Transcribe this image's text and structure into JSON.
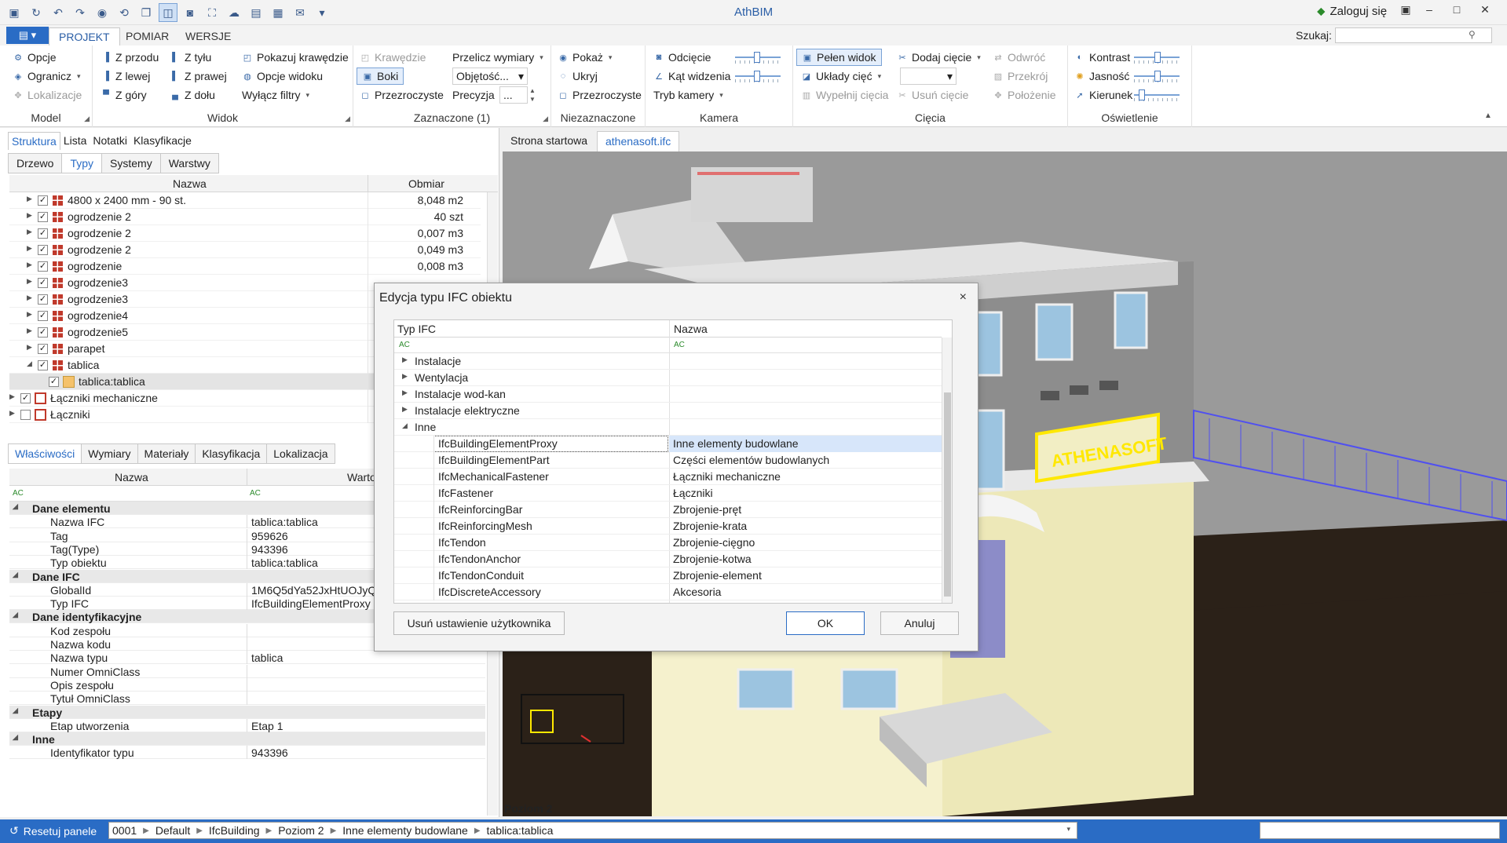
{
  "app": {
    "title": "AthBIM",
    "login": "Zaloguj się",
    "menu_tabs": [
      "PROJEKT",
      "POMIAR",
      "WERSJE"
    ],
    "search_label": "Szukaj:",
    "search_value": ""
  },
  "ribbon": {
    "model": {
      "label": "Model",
      "items": [
        "Opcje",
        "Ogranicz",
        "Lokalizacje"
      ]
    },
    "widok": {
      "label": "Widok",
      "items": [
        "Z przodu",
        "Z tyłu",
        "Z lewej",
        "Z prawej",
        "Z góry",
        "Z dołu",
        "Pokazuj krawędzie",
        "Opcje widoku",
        "Wyłącz filtry"
      ]
    },
    "zaznaczone": {
      "label": "Zaznaczone (1)",
      "items": [
        "Krawędzie",
        "Boki",
        "Przezroczyste",
        "Przelicz wymiary",
        "Objętość...",
        "Precyzja",
        "..."
      ]
    },
    "niezaznaczone": {
      "label": "Niezaznaczone",
      "items": [
        "Pokaż",
        "Ukryj",
        "Przezroczyste"
      ]
    },
    "kamera": {
      "label": "Kamera",
      "items": [
        "Odcięcie",
        "Kąt widzenia",
        "Tryb kamery"
      ]
    },
    "ciecia": {
      "label": "Cięcia",
      "items": [
        "Pełen widok",
        "Układy cięć",
        "Wypełnij cięcia",
        "Dodaj cięcie",
        "Usuń cięcie",
        "Odwróć",
        "Przekrój",
        "Położenie"
      ]
    },
    "oswietlenie": {
      "label": "Oświetlenie",
      "items": [
        "Kontrast",
        "Jasność",
        "Kierunek"
      ]
    }
  },
  "left_panel": {
    "tabs": [
      "Struktura",
      "Lista",
      "Notatki",
      "Klasyfikacje"
    ],
    "subtabs": [
      "Drzewo",
      "Typy",
      "Systemy",
      "Warstwy"
    ],
    "tree_headers": [
      "Nazwa",
      "Obmiar"
    ],
    "tree_rows": [
      {
        "name": "4800 x 2400 mm - 90 st.",
        "value": "8,048 m2"
      },
      {
        "name": "ogrodzenie 2",
        "value": "40 szt"
      },
      {
        "name": "ogrodzenie 2",
        "value": "0,007 m3"
      },
      {
        "name": "ogrodzenie 2",
        "value": "0,049 m3"
      },
      {
        "name": "ogrodzenie",
        "value": "0,008 m3"
      },
      {
        "name": "ogrodzenie3",
        "value": ""
      },
      {
        "name": "ogrodzenie3",
        "value": ""
      },
      {
        "name": "ogrodzenie4",
        "value": ""
      },
      {
        "name": "ogrodzenie5",
        "value": ""
      },
      {
        "name": "parapet",
        "value": ""
      },
      {
        "name": "tablica",
        "value": ""
      },
      {
        "name": "tablica:tablica",
        "value": ""
      },
      {
        "name": "Łączniki mechaniczne",
        "value": ""
      },
      {
        "name": "Łączniki",
        "value": ""
      }
    ],
    "prop_tabs": [
      "Właściwości",
      "Wymiary",
      "Materiały",
      "Klasyfikacja",
      "Lokalizacja"
    ],
    "prop_headers": [
      "Nazwa",
      "Wartość"
    ],
    "filter_icon": "AC",
    "props": [
      {
        "cat": true,
        "name": "Dane elementu"
      },
      {
        "name": "Nazwa IFC",
        "value": "tablica:tablica"
      },
      {
        "name": "Tag",
        "value": "959626"
      },
      {
        "name": "Tag(Type)",
        "value": "943396"
      },
      {
        "name": "Typ obiektu",
        "value": "tablica:tablica"
      },
      {
        "cat": true,
        "name": "Dane IFC"
      },
      {
        "name": "GlobalId",
        "value": "1M6Q5dYa52JxHtUOJyQ"
      },
      {
        "name": "Typ IFC",
        "value": "IfcBuildingElementProxy"
      },
      {
        "cat": true,
        "name": "Dane identyfikacyjne"
      },
      {
        "name": "Kod zespołu",
        "value": ""
      },
      {
        "name": "Nazwa kodu",
        "value": ""
      },
      {
        "name": "Nazwa typu",
        "value": "tablica"
      },
      {
        "name": "Numer OmniClass",
        "value": ""
      },
      {
        "name": "Opis zespołu",
        "value": ""
      },
      {
        "name": "Tytuł OmniClass",
        "value": ""
      },
      {
        "cat": true,
        "name": "Etapy"
      },
      {
        "name": "Etap utworzenia",
        "value": "Etap 1"
      },
      {
        "cat": true,
        "name": "Inne"
      },
      {
        "name": "Identyfikator typu",
        "value": "943396"
      }
    ]
  },
  "view": {
    "tabs": [
      "Strona startowa",
      "athenasoft.ifc"
    ],
    "level_label": "Poziom 2",
    "sign_text": "ATHENASOFT"
  },
  "dialog": {
    "title": "Edycja typu IFC obiektu",
    "close": "×",
    "headers": [
      "Typ IFC",
      "Nazwa"
    ],
    "filter_icon": "AC",
    "groups": [
      "Instalacje",
      "Wentylacja",
      "Instalacje wod-kan",
      "Instalacje elektryczne",
      "Inne"
    ],
    "rows": [
      {
        "type": "IfcBuildingElementProxy",
        "name": "Inne elementy budowlane"
      },
      {
        "type": "IfcBuildingElementPart",
        "name": "Części elementów budowlanych"
      },
      {
        "type": "IfcMechanicalFastener",
        "name": "Łączniki mechaniczne"
      },
      {
        "type": "IfcFastener",
        "name": "Łączniki"
      },
      {
        "type": "IfcReinforcingBar",
        "name": "Zbrojenie-pręt"
      },
      {
        "type": "IfcReinforcingMesh",
        "name": "Zbrojenie-krata"
      },
      {
        "type": "IfcTendon",
        "name": "Zbrojenie-cięgno"
      },
      {
        "type": "IfcTendonAnchor",
        "name": "Zbrojenie-kotwa"
      },
      {
        "type": "IfcTendonConduit",
        "name": "Zbrojenie-element"
      },
      {
        "type": "IfcDiscreteAccessory",
        "name": "Akcesoria"
      }
    ],
    "btn_reset": "Usuń ustawienie użytkownika",
    "btn_ok": "OK",
    "btn_cancel": "Anuluj"
  },
  "statusbar": {
    "reset": "Resetuj panele",
    "crumbs": [
      "0001",
      "Default",
      "IfcBuilding",
      "Poziom 2",
      "Inne elementy budowlane",
      "tablica:tablica"
    ]
  },
  "colors": {
    "accent": "#2a6cc5",
    "wall": "#f2eec4",
    "roof": "#6f6f6f",
    "ground": "#2b2118"
  }
}
